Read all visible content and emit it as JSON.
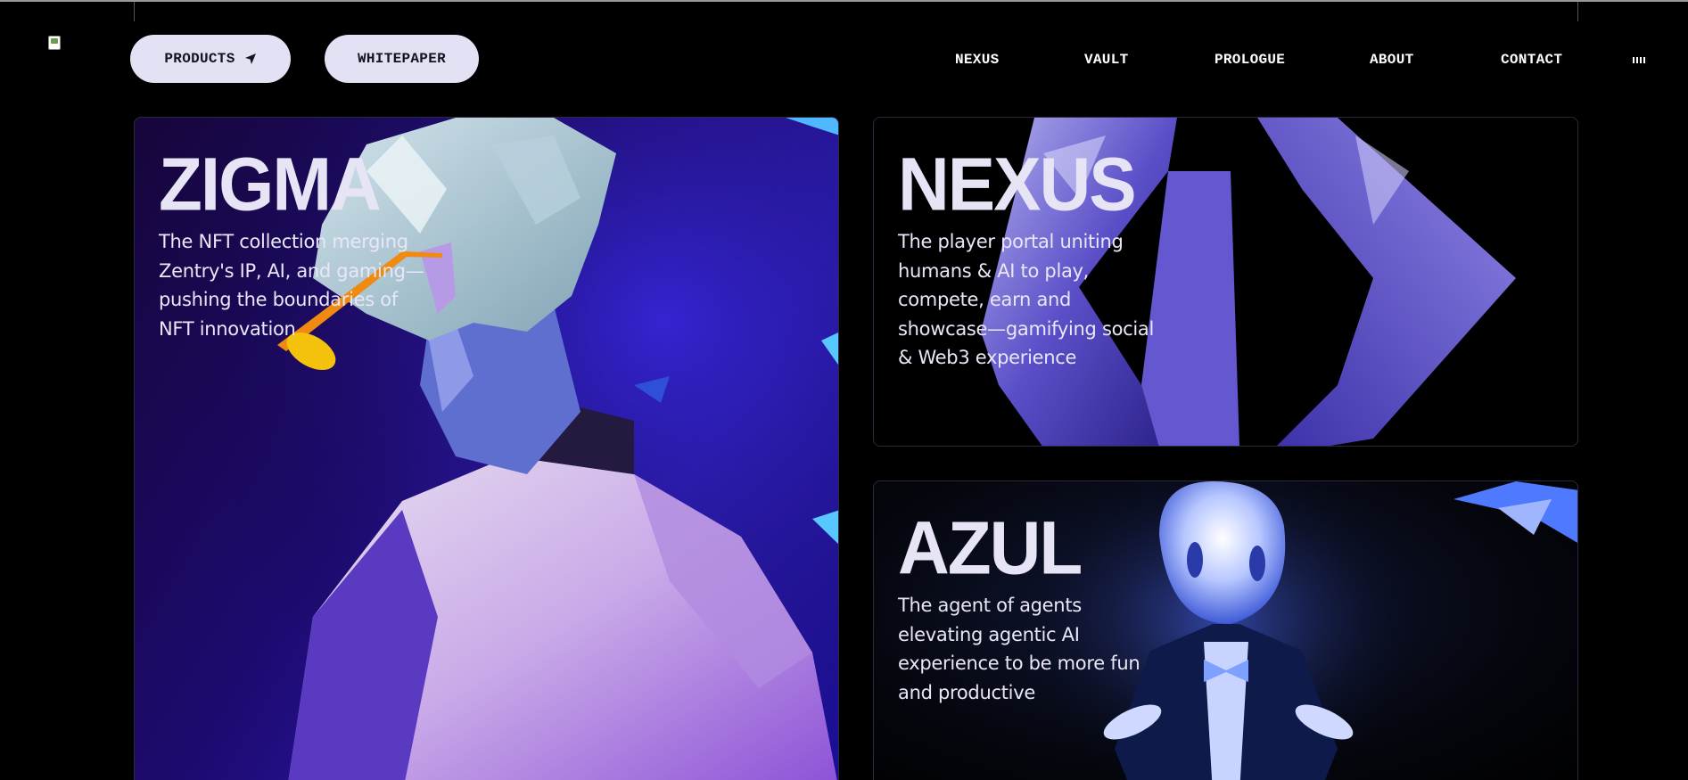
{
  "header": {
    "products_label": "PRODUCTS",
    "whitepaper_label": "WHITEPAPER",
    "nav": [
      "NEXUS",
      "VAULT",
      "PROLOGUE",
      "ABOUT",
      "CONTACT"
    ]
  },
  "cards": [
    {
      "title": "ZIGMA",
      "description": "The NFT collection merging Zentry's IP, AI, and gaming—pushing the boundaries of NFT innovation"
    },
    {
      "title": "NEXUS",
      "description": "The player portal uniting humans & AI to play, compete, earn and showcase—gamifying social & Web3 experience"
    },
    {
      "title": "AZUL",
      "description": "The agent of agents elevating agentic AI experience to be more fun and productive"
    }
  ],
  "colors": {
    "pill_bg": "#e3e1f4",
    "text_light": "#e6e4f5",
    "zigma_bg": "#1e0a70",
    "accent_blue": "#6f7fff"
  },
  "icons": [
    "broken-image-icon",
    "send-arrow-icon",
    "menu-bars-icon"
  ]
}
